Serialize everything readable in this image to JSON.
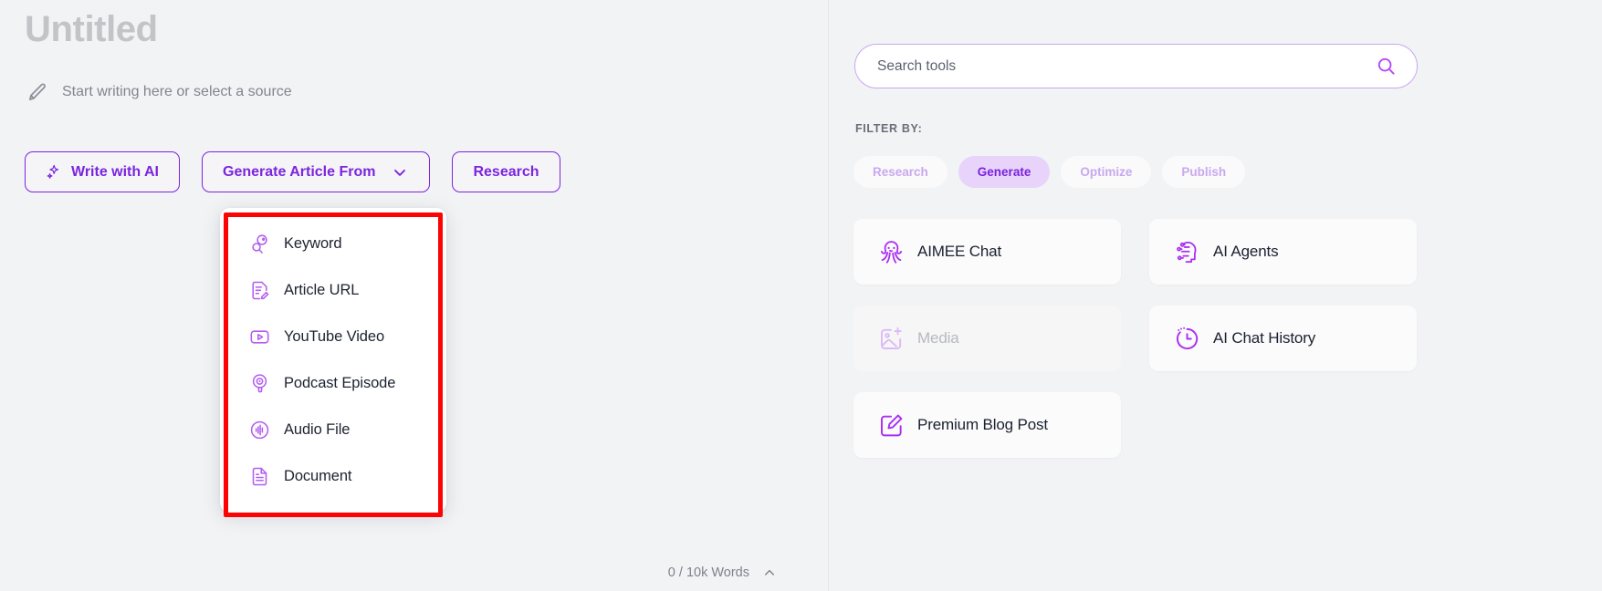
{
  "editor": {
    "title": "Untitled",
    "placeholder": "Start writing here or select a source",
    "pencil_icon": "pencil-icon",
    "buttons": [
      {
        "label": "Write with AI",
        "icon": "sparkle-icon",
        "has_chevron": false
      },
      {
        "label": "Generate Article From",
        "icon": null,
        "has_chevron": true
      },
      {
        "label": "Research",
        "icon": null,
        "has_chevron": false
      }
    ],
    "word_count": "0 / 10k Words",
    "word_count_chevron": "chevron-up-icon"
  },
  "dropdown": {
    "highlight_color": "#fc0404",
    "items": [
      {
        "label": "Keyword",
        "icon": "keyword-search-icon"
      },
      {
        "label": "Article URL",
        "icon": "article-edit-icon"
      },
      {
        "label": "YouTube Video",
        "icon": "youtube-play-icon"
      },
      {
        "label": "Podcast Episode",
        "icon": "podcast-mic-icon"
      },
      {
        "label": "Audio File",
        "icon": "audio-waveform-icon"
      },
      {
        "label": "Document",
        "icon": "document-icon"
      }
    ]
  },
  "tools": {
    "search": {
      "placeholder": "Search tools",
      "value": "",
      "icon": "search-icon"
    },
    "filter_label": "FILTER BY:",
    "filters": [
      {
        "label": "Research",
        "active": false
      },
      {
        "label": "Generate",
        "active": true
      },
      {
        "label": "Optimize",
        "active": false
      },
      {
        "label": "Publish",
        "active": false
      }
    ],
    "cards": [
      {
        "label": "AIMEE Chat",
        "icon": "octopus-icon",
        "disabled": false
      },
      {
        "label": "Media",
        "icon": "image-add-icon",
        "disabled": true
      },
      {
        "label": "Premium Blog Post",
        "icon": "edit-square-icon",
        "disabled": false
      },
      {
        "label": "AI Agents",
        "icon": "ai-brain-circuit-icon",
        "disabled": false
      },
      {
        "label": "AI Chat History",
        "icon": "clock-history-icon",
        "disabled": false
      }
    ]
  },
  "colors": {
    "accent_purple": "#7b25de",
    "icon_purple": "#b35cf0",
    "highlight_red": "#fc0404",
    "pill_active_bg": "#e8d4fb",
    "background": "#f2f3f5"
  }
}
